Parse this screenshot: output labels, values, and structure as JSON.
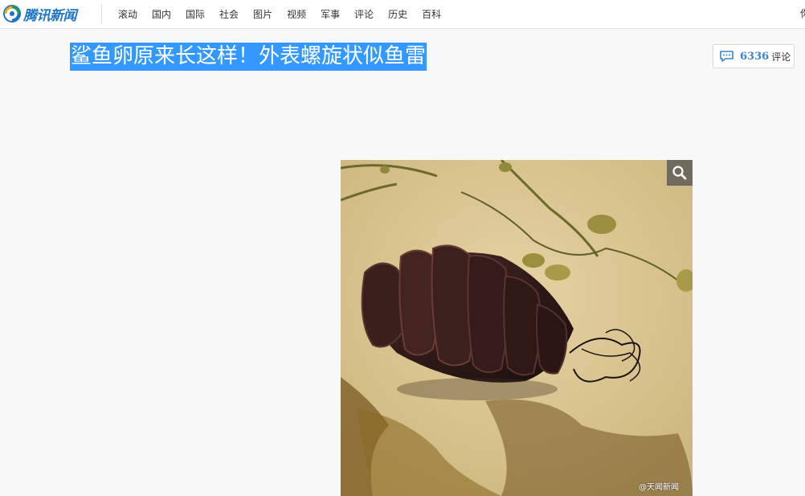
{
  "header": {
    "logo_text": "腾讯新闻",
    "nav_items": [
      "滚动",
      "国内",
      "国际",
      "社会",
      "图片",
      "视频",
      "军事",
      "评论",
      "历史",
      "百科"
    ],
    "nav_right": "你"
  },
  "article": {
    "title": "鲨鱼卵原来长这样！外表螺旋状似鱼雷",
    "comment_count": "6336",
    "comment_label": "评论"
  },
  "image": {
    "watermark": "@天闻新闻",
    "zoom_icon": "magnifier-icon"
  },
  "colors": {
    "selection": "#3399ff",
    "brand": "#1b74c8",
    "comment_accent": "#3a83d6"
  }
}
